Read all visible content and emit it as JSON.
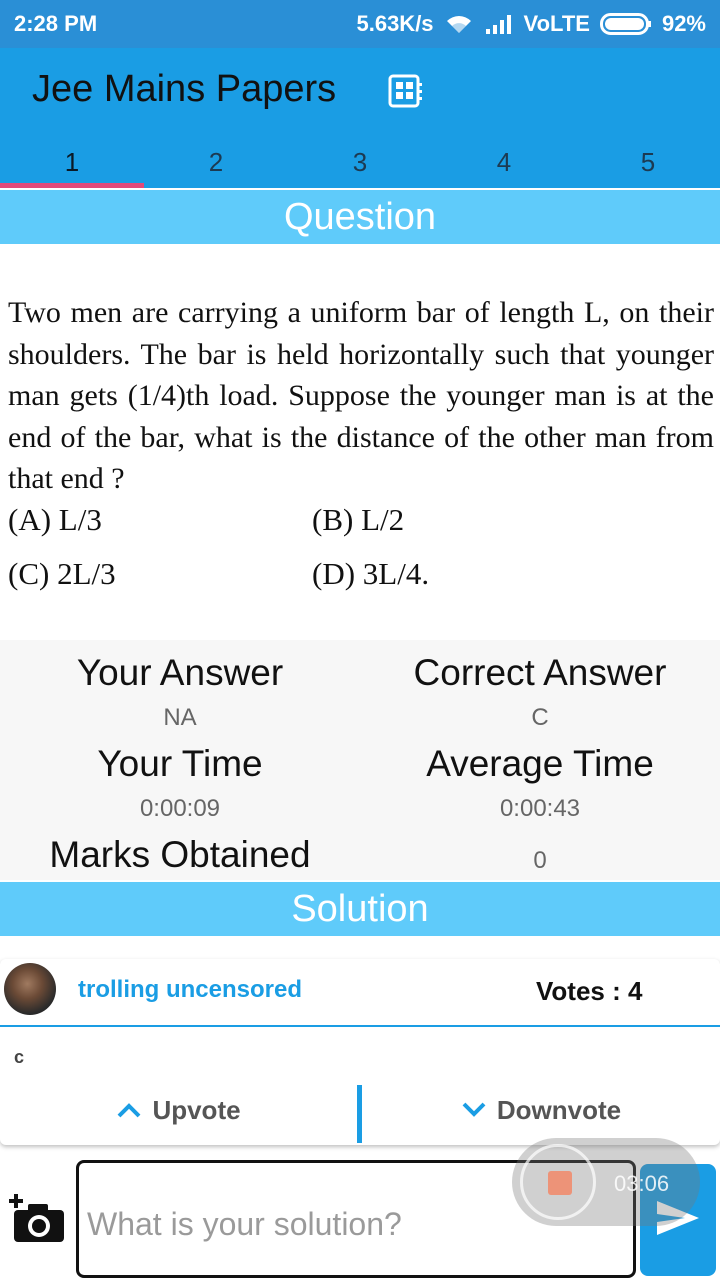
{
  "status_bar": {
    "time": "2:28 PM",
    "speed": "5.63K/s",
    "network": "VoLTE",
    "battery": "92%"
  },
  "app_bar": {
    "title": "Jee Mains Papers",
    "icon": "grid-document-icon"
  },
  "tabs": [
    {
      "label": "1",
      "active": true
    },
    {
      "label": "2",
      "active": false
    },
    {
      "label": "3",
      "active": false
    },
    {
      "label": "4",
      "active": false
    },
    {
      "label": "5",
      "active": false
    }
  ],
  "question_section": {
    "header": "Question",
    "text": "Two men are carrying a uniform bar of length L, on their shoulders. The bar is held horizontally such that younger man gets (1/4)th load. Suppose the younger man is at the end of the bar, what is the distance of the other man from that end ?",
    "options": {
      "a": "(A)  L/3",
      "b": "(B) L/2",
      "c": "(C)  2L/3",
      "d": "(D) 3L/4."
    }
  },
  "stats": {
    "your_answer_label": "Your Answer",
    "your_answer_value": "NA",
    "correct_answer_label": "Correct Answer",
    "correct_answer_value": "C",
    "your_time_label": "Your Time",
    "your_time_value": "0:00:09",
    "average_time_label": "Average Time",
    "average_time_value": "0:00:43",
    "marks_label": "Marks Obtained",
    "marks_value": "0"
  },
  "solution_section": {
    "header": "Solution",
    "username": "trolling uncensored",
    "votes": "Votes : 4",
    "text": "c",
    "upvote_label": "Upvote",
    "downvote_label": "Downvote"
  },
  "composer": {
    "placeholder": "What is your solution?",
    "recording_time": "03:06"
  },
  "colors": {
    "status_bar": "#2a8fd6",
    "app_bar": "#1a9de4",
    "section_header": "#5fcbfa",
    "tab_indicator": "#e3497a",
    "username": "#1a9de4"
  }
}
